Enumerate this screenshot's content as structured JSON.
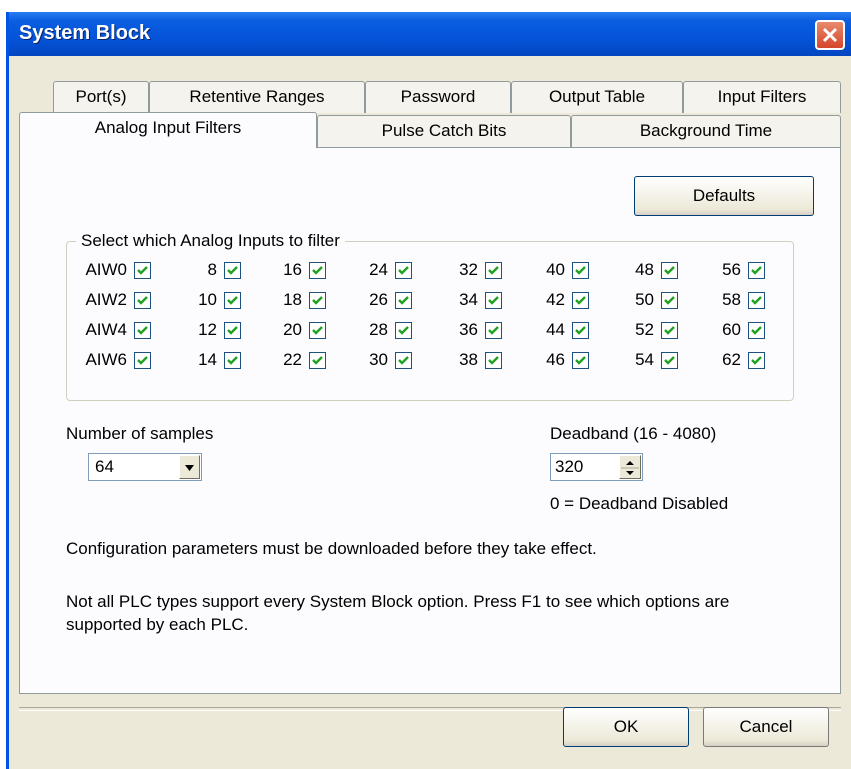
{
  "window": {
    "title": "System Block"
  },
  "tabs_back": [
    "Port(s)",
    "Retentive Ranges",
    "Password",
    "Output Table",
    "Input Filters"
  ],
  "tabs_front": [
    "Analog Input Filters",
    "Pulse Catch Bits",
    "Background Time"
  ],
  "active_tab": "Analog Input Filters",
  "defaults_button": "Defaults",
  "group_title": "Select which Analog Inputs to filter",
  "inputs": [
    [
      {
        "label": "AIW0",
        "checked": true
      },
      {
        "label": "8",
        "checked": true
      },
      {
        "label": "16",
        "checked": true
      },
      {
        "label": "24",
        "checked": true
      },
      {
        "label": "32",
        "checked": true
      },
      {
        "label": "40",
        "checked": true
      },
      {
        "label": "48",
        "checked": true
      },
      {
        "label": "56",
        "checked": true
      }
    ],
    [
      {
        "label": "AIW2",
        "checked": true
      },
      {
        "label": "10",
        "checked": true
      },
      {
        "label": "18",
        "checked": true
      },
      {
        "label": "26",
        "checked": true
      },
      {
        "label": "34",
        "checked": true
      },
      {
        "label": "42",
        "checked": true
      },
      {
        "label": "50",
        "checked": true
      },
      {
        "label": "58",
        "checked": true
      }
    ],
    [
      {
        "label": "AIW4",
        "checked": true
      },
      {
        "label": "12",
        "checked": true
      },
      {
        "label": "20",
        "checked": true
      },
      {
        "label": "28",
        "checked": true
      },
      {
        "label": "36",
        "checked": true
      },
      {
        "label": "44",
        "checked": true
      },
      {
        "label": "52",
        "checked": true
      },
      {
        "label": "60",
        "checked": true
      }
    ],
    [
      {
        "label": "AIW6",
        "checked": true
      },
      {
        "label": "14",
        "checked": true
      },
      {
        "label": "22",
        "checked": true
      },
      {
        "label": "30",
        "checked": true
      },
      {
        "label": "38",
        "checked": true
      },
      {
        "label": "46",
        "checked": true
      },
      {
        "label": "54",
        "checked": true
      },
      {
        "label": "62",
        "checked": true
      }
    ]
  ],
  "samples": {
    "label": "Number of samples",
    "value": "64"
  },
  "deadband": {
    "label": "Deadband (16 - 4080)",
    "value": "320",
    "note": "0 = Deadband Disabled"
  },
  "messages": {
    "config": "Configuration parameters must be downloaded before they take effect.",
    "plc_line1": "Not all PLC types support every System Block option.  Press F1 to see which options are",
    "plc_line2": "supported by each PLC."
  },
  "buttons": {
    "ok": "OK",
    "cancel": "Cancel"
  },
  "colors": {
    "titlebar": "#0553d9",
    "dialog_bg": "#ece9d8",
    "close": "#d4462a",
    "checkmark": "#21a121"
  }
}
